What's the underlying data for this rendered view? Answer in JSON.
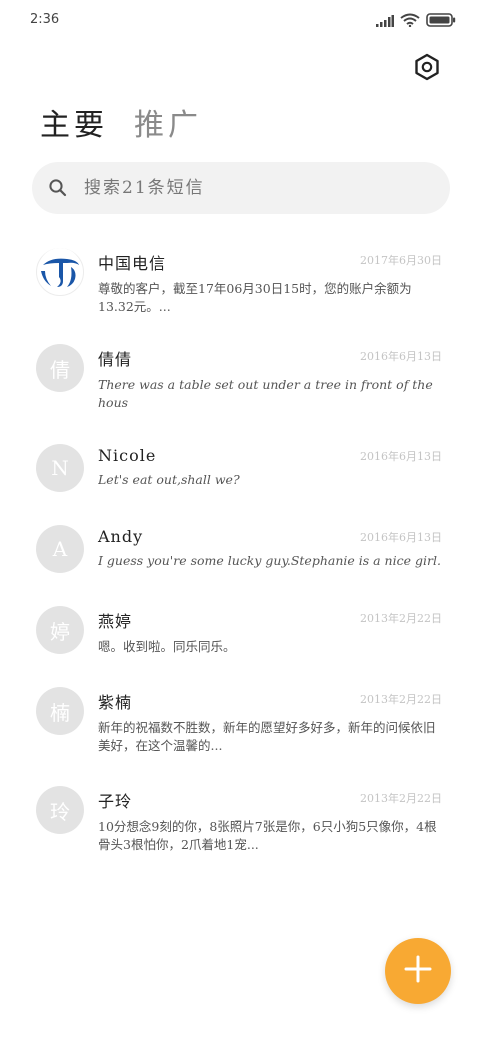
{
  "status": {
    "time": "2:36"
  },
  "tabs": [
    {
      "label": "主要",
      "active": true
    },
    {
      "label": "推广",
      "active": false
    }
  ],
  "search": {
    "placeholder": "搜索21条短信"
  },
  "conversations": [
    {
      "name": "中国电信",
      "date": "2017年6月30日",
      "preview": "尊敬的客户，截至17年06月30日15时，您的账户余额为13.32元。...",
      "avatar_text": "",
      "avatar_icon": "china-telecom-logo"
    },
    {
      "name": "倩倩",
      "date": "2016年6月13日",
      "preview": "There was a table set out under a tree in front of the hous",
      "avatar_text": "倩"
    },
    {
      "name": "Nicole",
      "date": "2016年6月13日",
      "preview": "Let's eat out,shall we?",
      "avatar_text": "N"
    },
    {
      "name": "Andy",
      "date": "2016年6月13日",
      "preview": "I guess you're some lucky guy.Stephanie is a nice girl.",
      "avatar_text": "A"
    },
    {
      "name": "燕婷",
      "date": "2013年2月22日",
      "preview": "嗯。收到啦。同乐同乐。",
      "avatar_text": "婷"
    },
    {
      "name": "紫楠",
      "date": "2013年2月22日",
      "preview": "新年的祝福数不胜数，新年的愿望好多好多，新年的问候依旧美好，在这个温馨的...",
      "avatar_text": "楠"
    },
    {
      "name": "子玲",
      "date": "2013年2月22日",
      "preview": "10分想念9刻的你，8张照片7张是你，6只小狗5只像你，4根骨头3根怕你，2爪着地1宠...",
      "avatar_text": "玲"
    }
  ],
  "colors": {
    "fab": "#f8a933",
    "avatar_bg": "#e3e3e3",
    "telecom_blue": "#1a56a8"
  },
  "icons": {
    "settings": "settings-hexagon-icon",
    "search": "search-icon",
    "fab": "plus-icon"
  }
}
